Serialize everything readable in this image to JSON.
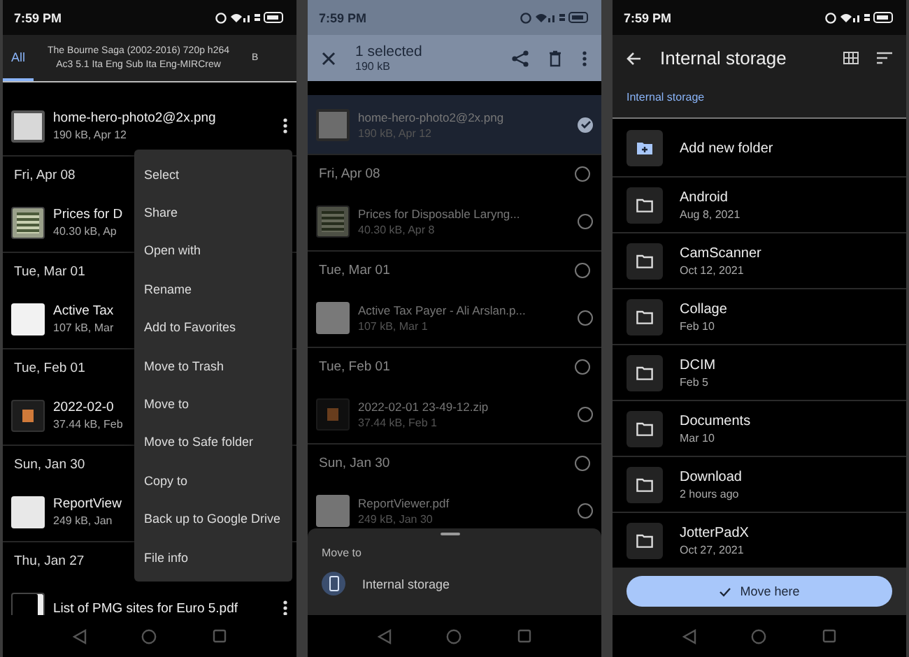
{
  "file_list_screen": {
    "status_time": "7:59 PM",
    "tabs": [
      {
        "label": "All",
        "selected": true
      },
      {
        "label": "The Bourne Saga (2002-2016) 720p h264 Ac3 5.1 Ita Eng Sub Ita Eng-MIRCrew",
        "selected": false
      },
      {
        "label": "B",
        "selected": false
      }
    ],
    "groups": [
      {
        "items": [
          {
            "name": "home-hero-photo2@2x.png",
            "details": "190 kB, Apr 12",
            "kind": "image",
            "more_button": true
          }
        ]
      },
      {
        "date": "Fri, Apr 08",
        "items": [
          {
            "name": "Prices for D",
            "details": "40.30 kB, Ap",
            "kind": "spreadsheet",
            "more_button": false
          }
        ]
      },
      {
        "date": "Tue, Mar 01",
        "items": [
          {
            "name": "Active Tax",
            "details": "107 kB, Mar",
            "kind": "document",
            "more_button": false
          }
        ]
      },
      {
        "date": "Tue, Feb 01",
        "items": [
          {
            "name": "2022-02-0",
            "details": "37.44 kB, Feb",
            "kind": "archive",
            "more_button": false
          }
        ]
      },
      {
        "date": "Sun, Jan 30",
        "items": [
          {
            "name": "ReportView",
            "details": "249 kB, Jan",
            "kind": "report",
            "more_button": false
          }
        ]
      },
      {
        "date": "Thu, Jan 27",
        "items": [
          {
            "name": "List of PMG sites for Euro 5.pdf",
            "kind": "pdf",
            "more_button": true
          }
        ]
      }
    ],
    "context_menu": {
      "items": [
        "Select",
        "Share",
        "Open with",
        "Rename",
        "Add to Favorites",
        "Move to Trash",
        "Move to",
        "Move to Safe folder",
        "Copy to",
        "Back up to Google Drive",
        "File info"
      ]
    }
  },
  "selection_screen": {
    "status_time": "7:59 PM",
    "title": "1 selected",
    "subtitle": "190 kB",
    "groups": [
      {
        "items": [
          {
            "name": "home-hero-photo2@2x.png",
            "details": "190 kB, Apr 12",
            "kind": "image",
            "selected": true
          }
        ]
      },
      {
        "date": "Fri, Apr 08",
        "selected": false,
        "items": [
          {
            "name": "Prices for Disposable Laryng...",
            "details": "40.30 kB, Apr 8",
            "kind": "spreadsheet",
            "selected": false
          }
        ]
      },
      {
        "date": "Tue, Mar 01",
        "selected": false,
        "items": [
          {
            "name": "Active Tax Payer - Ali Arslan.p...",
            "details": "107 kB, Mar 1",
            "kind": "document",
            "selected": false
          }
        ]
      },
      {
        "date": "Tue, Feb 01",
        "selected": false,
        "items": [
          {
            "name": "2022-02-01 23-49-12.zip",
            "details": "37.44 kB, Feb 1",
            "kind": "archive",
            "selected": false
          }
        ]
      },
      {
        "date": "Sun, Jan 30",
        "selected": false,
        "items": [
          {
            "name": "ReportViewer.pdf",
            "details": "249 kB, Jan 30",
            "kind": "report",
            "selected": false
          }
        ]
      }
    ],
    "sheet": {
      "title": "Move to",
      "destinations": [
        "Internal storage"
      ]
    }
  },
  "folder_picker_screen": {
    "status_time": "7:59 PM",
    "title": "Internal storage",
    "breadcrumb": "Internal storage",
    "rows": [
      {
        "kind": "action",
        "name": "Add new folder"
      },
      {
        "kind": "folder",
        "name": "Android",
        "date": "Aug 8, 2021"
      },
      {
        "kind": "folder",
        "name": "CamScanner",
        "date": "Oct 12, 2021"
      },
      {
        "kind": "folder",
        "name": "Collage",
        "date": "Feb 10"
      },
      {
        "kind": "folder",
        "name": "DCIM",
        "date": "Feb 5"
      },
      {
        "kind": "folder",
        "name": "Documents",
        "date": "Mar 10"
      },
      {
        "kind": "folder",
        "name": "Download",
        "date": "2 hours ago"
      },
      {
        "kind": "folder",
        "name": "JotterPadX",
        "date": "Oct 27, 2021"
      }
    ],
    "button": "Move here"
  }
}
